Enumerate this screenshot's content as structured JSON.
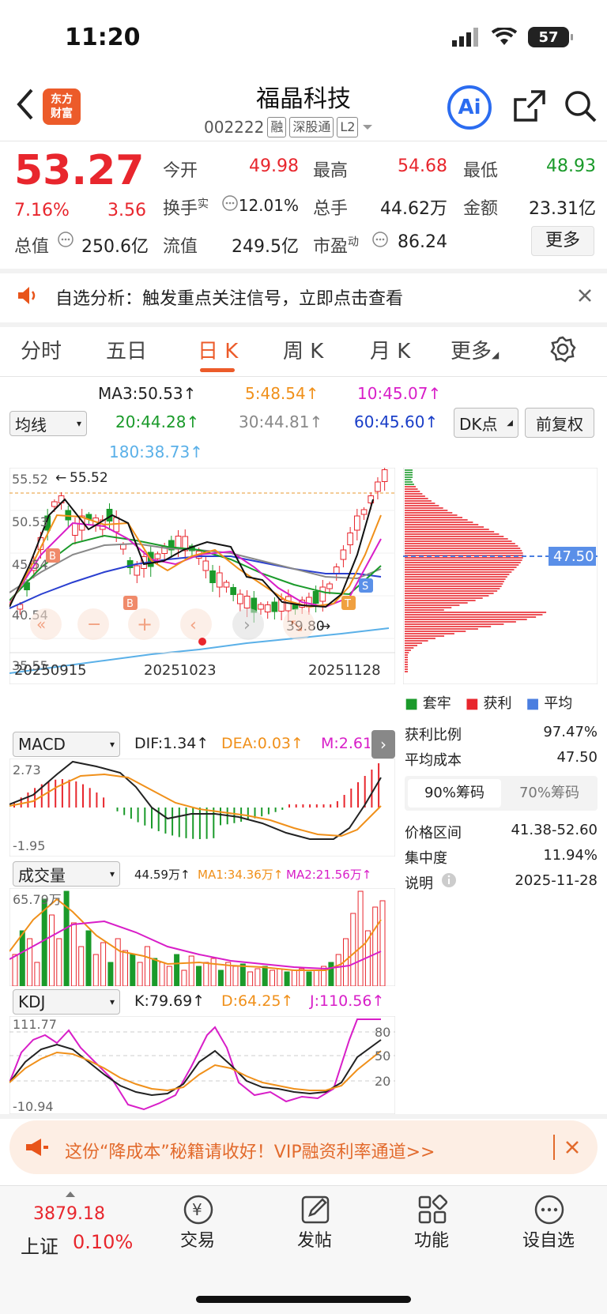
{
  "status_bar": {
    "time": "11:20",
    "battery": "57"
  },
  "header": {
    "logo_line1": "东方",
    "logo_line2": "财富",
    "stock_name": "福晶科技",
    "stock_code": "002222",
    "tags": [
      "融",
      "深股通",
      "L2"
    ],
    "ai_label": "Ai"
  },
  "quote": {
    "price": "53.27",
    "change_pct": "7.16%",
    "change": "3.56",
    "open_label": "今开",
    "open": "49.98",
    "high_label": "最高",
    "high": "54.68",
    "low_label": "最低",
    "low": "48.93",
    "turnover_label": "换手",
    "turnover_sup": "实",
    "turnover": "12.01%",
    "volume_label": "总手",
    "volume": "44.62万",
    "amount_label": "金额",
    "amount": "23.31亿",
    "mcap_label": "总值",
    "mcap": "250.6亿",
    "float_label": "流值",
    "float": "249.5亿",
    "pe_label": "市盈",
    "pe_sup": "动",
    "pe": "86.24",
    "more_label": "更多"
  },
  "alert": {
    "text": "自选分析：触发重点关注信号，立即点击查看"
  },
  "tabs": [
    "分时",
    "五日",
    "日 K",
    "周 K",
    "月 K",
    "更多"
  ],
  "active_tab": "日 K",
  "ma": {
    "selector": "均线",
    "ma3": "MA3:50.53↑",
    "ma5": "5:48.54↑",
    "ma10": "10:45.07↑",
    "ma20": "20:44.28↑",
    "ma30": "30:44.81↑",
    "ma60": "60:45.60↑",
    "ma180": "180:38.73↑",
    "dk_label": "DK点",
    "fuquan_label": "前复权"
  },
  "kline": {
    "y_ticks": [
      "55.52",
      "50.53",
      "45.54",
      "40.54",
      "35.55"
    ],
    "high_marker": "55.52",
    "low_marker": "39.80",
    "dates": [
      "20250915",
      "20251023",
      "20251128"
    ],
    "chip_price": "47.50"
  },
  "chip": {
    "legend": [
      "套牢",
      "获利",
      "平均"
    ],
    "profit_ratio_label": "获利比例",
    "profit_ratio": "97.47%",
    "avg_cost_label": "平均成本",
    "avg_cost": "47.50",
    "tab90": "90%筹码",
    "tab70": "70%筹码",
    "range_label": "价格区间",
    "range": "41.38-52.60",
    "concentration_label": "集中度",
    "concentration": "11.94%",
    "note_label": "说明",
    "date": "2025-11-28"
  },
  "macd": {
    "selector": "MACD",
    "dif": "DIF:1.34↑",
    "dea": "DEA:0.03↑",
    "m": "M:2.61↑",
    "top": "2.73",
    "bottom": "-1.95"
  },
  "vol": {
    "selector": "成交量",
    "current": "44.59万↑",
    "ma1": "MA1:34.36万↑",
    "ma2": "MA2:21.56万↑",
    "top": "65.79万"
  },
  "kdj": {
    "selector": "KDJ",
    "k": "K:79.69↑",
    "d": "D:64.25↑",
    "j": "J:110.56↑",
    "top": "111.77",
    "bottom": "-10.94",
    "levels": [
      "80",
      "50",
      "20"
    ]
  },
  "promo": {
    "text": "这份“降成本”秘籍请收好！VIP融资利率通道>>"
  },
  "bottom_nav": {
    "index_value": "3879.18",
    "index_name": "上证",
    "index_pct": "0.10%",
    "items": [
      "交易",
      "发帖",
      "功能",
      "设自选"
    ]
  }
}
